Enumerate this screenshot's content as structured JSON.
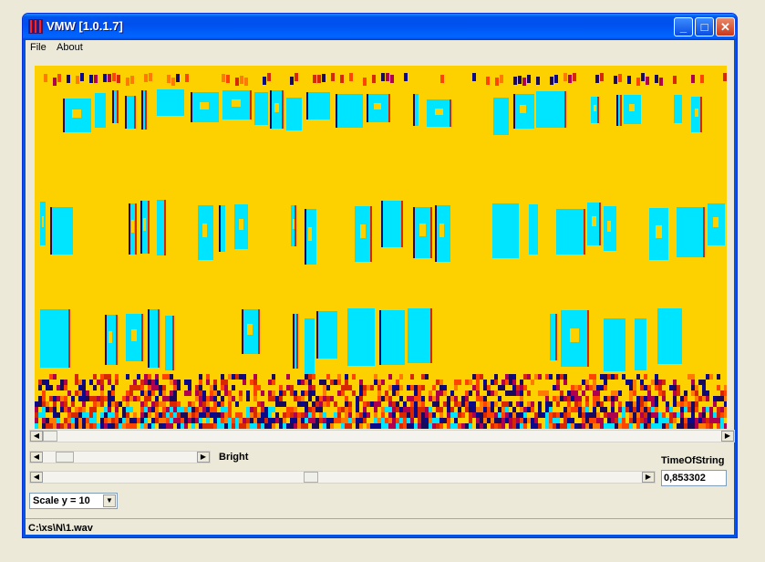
{
  "window": {
    "title": "VMW [1.0.1.7]"
  },
  "titlebar_buttons": {
    "minimize": "_",
    "maximize": "□",
    "close": "✕"
  },
  "menu": {
    "items": [
      "File",
      "About"
    ]
  },
  "spectrogram": {
    "background_color": "#fdd000",
    "highlight_color": "#00e5ff",
    "noise_colors": [
      "#d72800",
      "#1a0a5a",
      "#ff7a00",
      "#b00050",
      "#ff4400",
      "#0a0a8a"
    ]
  },
  "controls": {
    "bright_label": "Bright",
    "time_of_string_label": "TimeOfString",
    "time_of_string_value": "0,853302",
    "scale_select": {
      "selected": "Scale y = 10"
    }
  },
  "status": {
    "path": "C:\\xs\\N\\1.wav"
  }
}
